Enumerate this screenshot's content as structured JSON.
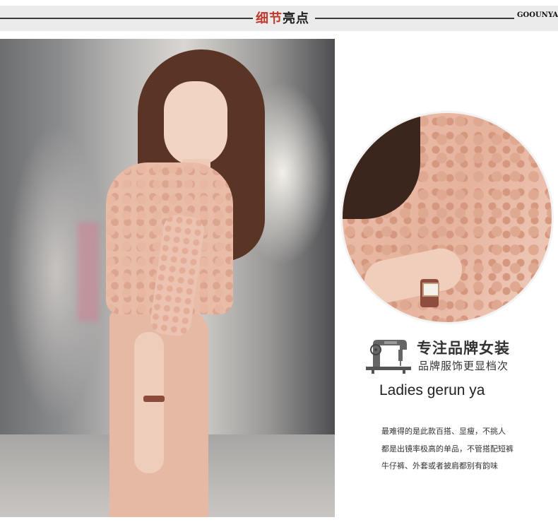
{
  "header": {
    "title_part1": "细节",
    "title_part2": "亮点",
    "brand": "GOOUNYA"
  },
  "colors": {
    "accent_red": "#c0392b",
    "header_band": "#ebebeb",
    "dress_pink": "#e9bca8"
  },
  "icons": {
    "sewing_machine": "sewing-machine-icon"
  },
  "detail": {
    "heading": "专注品牌女装",
    "subheading": "品牌服饰更显档次",
    "brand_line": "Ladies gerun ya",
    "description": [
      "最难得的是此款百搭、显瘦，不挑人",
      "都是出镜率极高的单品，不管搭配短裤",
      "牛仔裤、外套或者披肩都别有韵味"
    ]
  }
}
